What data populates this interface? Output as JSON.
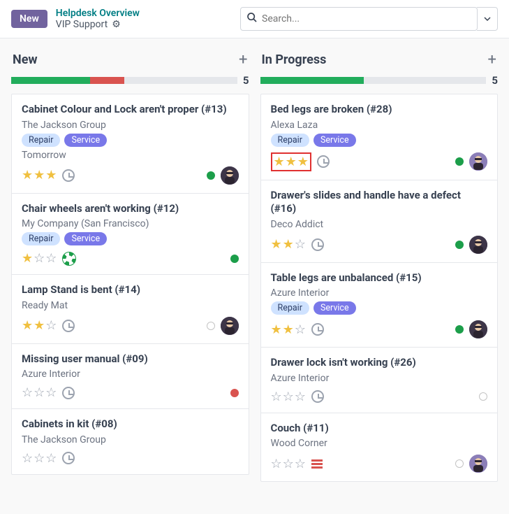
{
  "header": {
    "new_button": "New",
    "breadcrumb_top": "Helpdesk Overview",
    "breadcrumb_current": "VIP Support",
    "search_placeholder": "Search..."
  },
  "columns": [
    {
      "title": "New",
      "count": "5",
      "bar_segments": [
        {
          "color": "seg-green",
          "width": "35%"
        },
        {
          "color": "seg-red",
          "width": "15%"
        }
      ],
      "cards": [
        {
          "title": "Cabinet Colour and Lock aren't proper (#13)",
          "subtitle": "The Jackson Group",
          "tags": [
            "Repair",
            "Service"
          ],
          "due": "Tomorrow",
          "stars": 3,
          "clock": true,
          "dot": "green",
          "avatar": "dark"
        },
        {
          "title": "Chair wheels aren't working (#12)",
          "subtitle": "My Company (San Francisco)",
          "tags": [
            "Repair",
            "Service"
          ],
          "stars": 1,
          "life": true,
          "dot": "green"
        },
        {
          "title": "Lamp Stand is bent (#14)",
          "subtitle": "Ready Mat",
          "stars": 2,
          "clock": true,
          "dot": "empty",
          "avatar": "dark"
        },
        {
          "title": "Missing user manual (#09)",
          "subtitle": "Azure Interior",
          "stars": 0,
          "clock": true,
          "dot": "red"
        },
        {
          "title": "Cabinets in kit (#08)",
          "subtitle": "The Jackson Group",
          "stars": 0,
          "clock": true
        }
      ]
    },
    {
      "title": "In Progress",
      "count": "5",
      "bar_segments": [
        {
          "color": "seg-green",
          "width": "46%"
        }
      ],
      "cards": [
        {
          "title": "Bed legs are broken (#28)",
          "subtitle": "Alexa Laza",
          "tags": [
            "Repair",
            "Service"
          ],
          "stars": 3,
          "clock": true,
          "highlight": true,
          "dot": "green",
          "avatar": "purple"
        },
        {
          "title": "Drawer's slides and handle have a defect (#16)",
          "subtitle": "Deco Addict",
          "stars": 2,
          "clock": true,
          "dot": "green",
          "avatar": "dark"
        },
        {
          "title": "Table legs are unbalanced (#15)",
          "subtitle": "Azure Interior",
          "tags": [
            "Repair",
            "Service"
          ],
          "stars": 2,
          "clock": true,
          "dot": "green",
          "avatar": "dark"
        },
        {
          "title": "Drawer lock isn't working (#26)",
          "subtitle": "Azure Interior",
          "stars": 0,
          "clock": true,
          "dot": "empty"
        },
        {
          "title": "Couch (#11)",
          "subtitle": "Wood Corner",
          "stars": 0,
          "bars": true,
          "dot": "empty",
          "avatar": "purple"
        }
      ]
    }
  ]
}
